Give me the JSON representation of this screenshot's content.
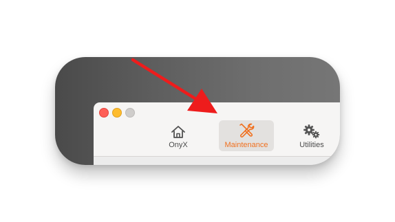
{
  "toolbar": {
    "items": [
      {
        "label": "OnyX",
        "icon": "house-icon",
        "selected": false
      },
      {
        "label": "Maintenance",
        "icon": "wrench-screwdriver-icon",
        "selected": true
      },
      {
        "label": "Utilities",
        "icon": "gears-icon",
        "selected": false
      }
    ]
  },
  "colors": {
    "selected_accent": "#f0701f",
    "annotation_arrow": "#ee1c1c",
    "close": "#fe5f57",
    "minimize": "#febc2e",
    "zoom_disabled": "#cfcdcb"
  }
}
